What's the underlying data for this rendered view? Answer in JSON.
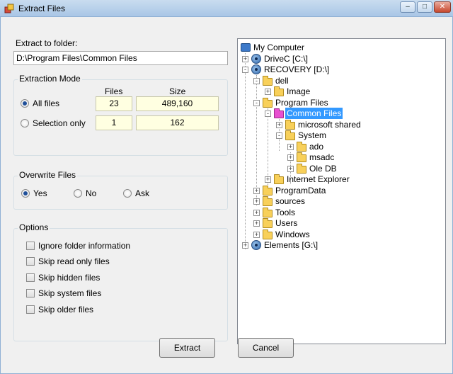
{
  "window": {
    "title": "Extract Files"
  },
  "extract_to": {
    "label": "Extract to folder:",
    "value": "D:\\Program Files\\Common Files"
  },
  "extraction_mode": {
    "title": "Extraction Mode",
    "col_files": "Files",
    "col_size": "Size",
    "rows": [
      {
        "label": "All files",
        "files": "23",
        "size": "489,160",
        "checked": true
      },
      {
        "label": "Selection only",
        "files": "1",
        "size": "162",
        "checked": false
      }
    ]
  },
  "overwrite": {
    "title": "Overwrite Files",
    "options": [
      {
        "label": "Yes",
        "checked": true
      },
      {
        "label": "No",
        "checked": false
      },
      {
        "label": "Ask",
        "checked": false
      }
    ]
  },
  "options": {
    "title": "Options",
    "items": [
      {
        "label": "Ignore folder information",
        "checked": false
      },
      {
        "label": "Skip read only files",
        "checked": false
      },
      {
        "label": "Skip hidden files",
        "checked": false
      },
      {
        "label": "Skip system files",
        "checked": false
      },
      {
        "label": "Skip older files",
        "checked": false
      }
    ]
  },
  "tree": {
    "nodes": [
      {
        "label": "My Computer",
        "icon": "computer-icon"
      },
      {
        "label": "DriveC [C:\\]",
        "icon": "drive-icon",
        "expander": "+"
      },
      {
        "label": "RECOVERY [D:\\]",
        "icon": "drive-icon",
        "expander": "-"
      },
      {
        "label": "dell",
        "icon": "folder-icon",
        "expander": "-"
      },
      {
        "label": "Image",
        "icon": "folder-icon",
        "expander": "+"
      },
      {
        "label": "Program Files",
        "icon": "folder-icon",
        "expander": "-"
      },
      {
        "label": "Common Files",
        "icon": "folder-icon",
        "expander": "-",
        "selected": true
      },
      {
        "label": "microsoft shared",
        "icon": "folder-icon",
        "expander": "+"
      },
      {
        "label": "System",
        "icon": "folder-icon",
        "expander": "-"
      },
      {
        "label": "ado",
        "icon": "folder-icon",
        "expander": "+"
      },
      {
        "label": "msadc",
        "icon": "folder-icon",
        "expander": "+"
      },
      {
        "label": "Ole DB",
        "icon": "folder-icon",
        "expander": "+"
      },
      {
        "label": "Internet Explorer",
        "icon": "folder-icon",
        "expander": "+"
      },
      {
        "label": "ProgramData",
        "icon": "folder-icon",
        "expander": "+"
      },
      {
        "label": "sources",
        "icon": "folder-icon",
        "expander": "+"
      },
      {
        "label": "Tools",
        "icon": "folder-icon",
        "expander": "+"
      },
      {
        "label": "Users",
        "icon": "folder-icon",
        "expander": "+"
      },
      {
        "label": "Windows",
        "icon": "folder-icon",
        "expander": "+"
      },
      {
        "label": "Elements [G:\\]",
        "icon": "drive-icon",
        "expander": "+"
      }
    ]
  },
  "buttons": {
    "extract": "Extract",
    "cancel": "Cancel"
  },
  "colors": {
    "selection": "#3399ff",
    "cell_background": "#ffffe1",
    "folder": "#f8d05a",
    "selected_folder": "#e84fd0"
  }
}
